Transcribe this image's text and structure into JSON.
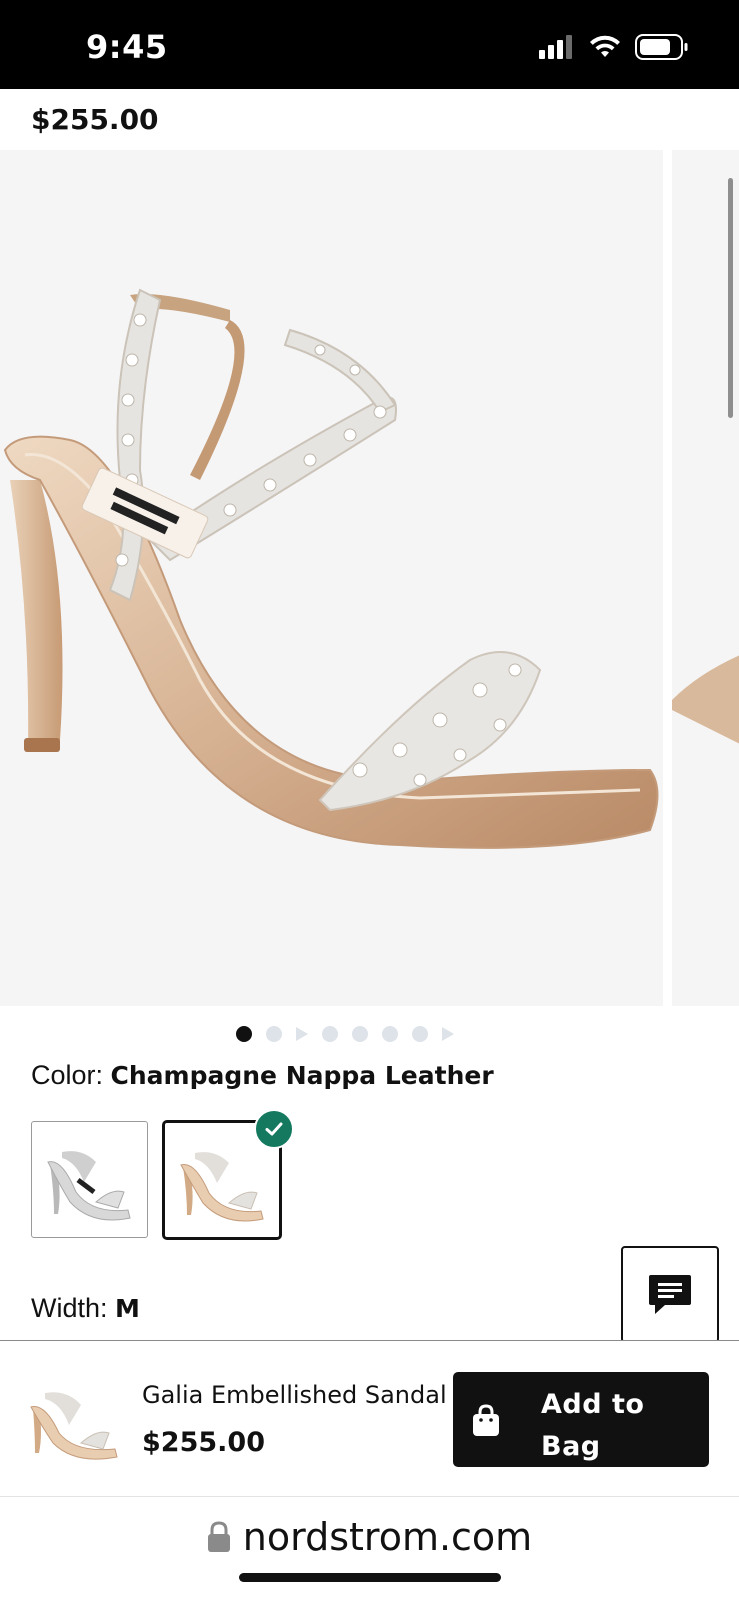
{
  "status_bar": {
    "time": "9:45"
  },
  "header": {
    "price": "$255.00"
  },
  "gallery": {
    "image_count": 8,
    "current_index": 1
  },
  "product": {
    "color_label": "Color: ",
    "color_value": "Champagne Nappa Leather",
    "width_label": "Width: ",
    "width_value": "M",
    "swatches": [
      {
        "name": "Crystal silver",
        "selected": false
      },
      {
        "name": "Champagne Nappa Leather",
        "selected": true
      }
    ]
  },
  "sticky": {
    "name": "Galia Embellished Sandal",
    "price": "$255.00",
    "add_label": "Add to Bag"
  },
  "browser": {
    "url": "nordstrom.com"
  },
  "colors": {
    "accent_black": "#111111",
    "check_green": "#14795f",
    "dot_inactive": "#dde3e8"
  }
}
